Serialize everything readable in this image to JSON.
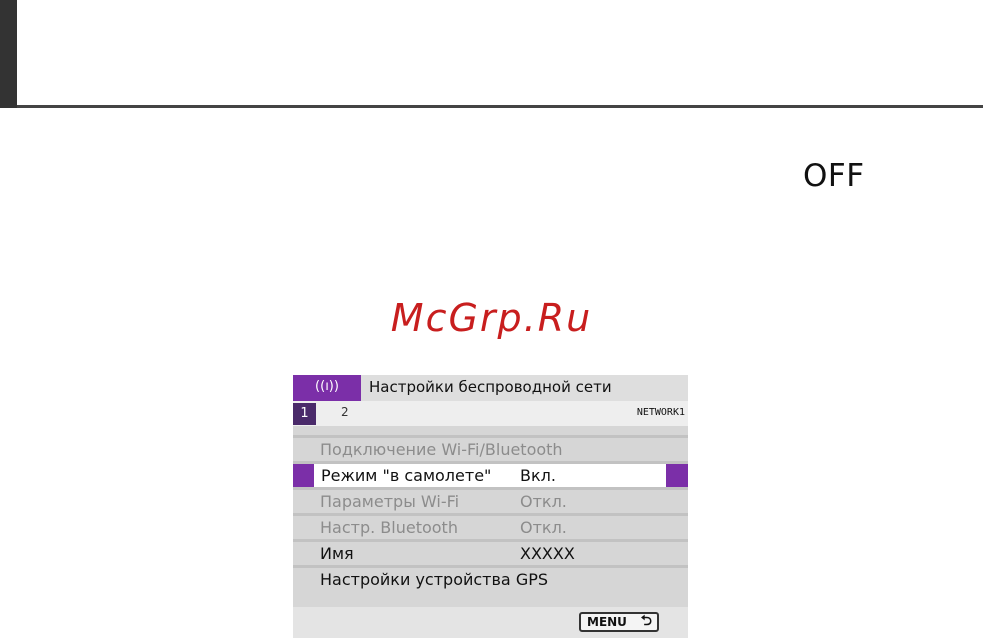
{
  "header": {
    "off_label": "OFF"
  },
  "watermark": "McGrp.Ru",
  "screen": {
    "title_icon": "((ı))",
    "title": "Настройки беспроводной сети",
    "tabs": [
      {
        "label": "1",
        "active": true
      },
      {
        "label": "2",
        "active": false
      }
    ],
    "network_label": "NETWORK1",
    "menu_items": [
      {
        "label": "Подключение Wi-Fi/Bluetooth",
        "value": "",
        "state": "disabled"
      },
      {
        "label": "Режим \"в самолете\"",
        "value": "Вкл.",
        "state": "selected"
      },
      {
        "label": "Параметры Wi-Fi",
        "value": "Откл.",
        "state": "disabled"
      },
      {
        "label": "Настр. Bluetooth",
        "value": "Откл.",
        "state": "disabled"
      },
      {
        "label": "Имя",
        "value": "XXXXX",
        "state": "enabled"
      },
      {
        "label": "Настройки устройства GPS",
        "value": "",
        "state": "enabled"
      }
    ],
    "menu_button": {
      "label": "MENU",
      "icon": "return-arrow-icon"
    },
    "accent_color": "#7b2fa8"
  }
}
